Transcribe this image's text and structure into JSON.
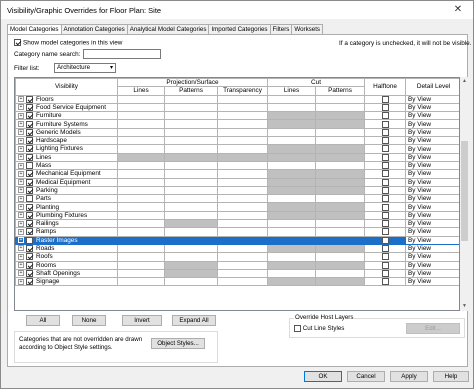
{
  "window": {
    "title": "Visibility/Graphic Overrides for Floor Plan: Site",
    "close_glyph": "✕"
  },
  "tabs": [
    {
      "label": "Model Categories",
      "active": true
    },
    {
      "label": "Annotation Categories",
      "active": false
    },
    {
      "label": "Analytical Model Categories",
      "active": false
    },
    {
      "label": "Imported Categories",
      "active": false
    },
    {
      "label": "Filters",
      "active": false
    },
    {
      "label": "Worksets",
      "active": false
    }
  ],
  "options": {
    "show_model_categories_label": "Show model categories in this view",
    "show_model_categories_checked": true,
    "hint": "If a category is unchecked, it will not be visible.",
    "category_search_label": "Category name search:",
    "category_search_value": "",
    "filter_list_label": "Filter list:",
    "filter_list_value": "Architecture",
    "dropdown_icon": "chevron-down-icon"
  },
  "table": {
    "headers": {
      "visibility": "Visibility",
      "projection_surface": "Projection/Surface",
      "cut": "Cut",
      "halftone": "Halftone",
      "detail_level": "Detail Level",
      "lines": "Lines",
      "patterns": "Patterns",
      "transparency": "Transparency",
      "cut_lines": "Lines",
      "cut_patterns": "Patterns"
    },
    "rows": [
      {
        "name": "Floors",
        "checked": true,
        "cut_gray": false,
        "proj_gray": false,
        "detail": "By View",
        "selected": false
      },
      {
        "name": "Food Service Equipment",
        "checked": true,
        "cut_gray": false,
        "proj_gray": false,
        "detail": "By View",
        "selected": false
      },
      {
        "name": "Furniture",
        "checked": true,
        "cut_gray": true,
        "proj_gray": false,
        "detail": "By View",
        "selected": false
      },
      {
        "name": "Furniture Systems",
        "checked": true,
        "cut_gray": true,
        "proj_gray": false,
        "detail": "By View",
        "selected": false
      },
      {
        "name": "Generic Models",
        "checked": true,
        "cut_gray": false,
        "proj_gray": false,
        "detail": "By View",
        "selected": false
      },
      {
        "name": "Hardscape",
        "checked": true,
        "cut_gray": false,
        "proj_gray": false,
        "detail": "By View",
        "selected": false
      },
      {
        "name": "Lighting Fixtures",
        "checked": true,
        "cut_gray": true,
        "proj_gray": false,
        "detail": "By View",
        "selected": false
      },
      {
        "name": "Lines",
        "checked": true,
        "cut_gray": true,
        "proj_gray": true,
        "detail": "By View",
        "selected": false
      },
      {
        "name": "Mass",
        "checked": false,
        "cut_gray": false,
        "proj_gray": false,
        "detail": "By View",
        "selected": false
      },
      {
        "name": "Mechanical Equipment",
        "checked": true,
        "cut_gray": true,
        "proj_gray": false,
        "detail": "By View",
        "selected": false
      },
      {
        "name": "Medical Equipment",
        "checked": true,
        "cut_gray": true,
        "proj_gray": false,
        "detail": "By View",
        "selected": false
      },
      {
        "name": "Parking",
        "checked": true,
        "cut_gray": true,
        "proj_gray": false,
        "detail": "By View",
        "selected": false
      },
      {
        "name": "Parts",
        "checked": false,
        "cut_gray": false,
        "proj_gray": false,
        "detail": "By View",
        "selected": false
      },
      {
        "name": "Planting",
        "checked": true,
        "cut_gray": true,
        "proj_gray": false,
        "detail": "By View",
        "selected": false
      },
      {
        "name": "Plumbing Fixtures",
        "checked": true,
        "cut_gray": true,
        "proj_gray": false,
        "detail": "By View",
        "selected": false
      },
      {
        "name": "Railings",
        "checked": true,
        "cut_gray": false,
        "proj_gray": false,
        "detail": "By View",
        "selected": false,
        "partial_gray": true
      },
      {
        "name": "Ramps",
        "checked": true,
        "cut_gray": false,
        "proj_gray": false,
        "detail": "By View",
        "selected": false
      },
      {
        "name": "Raster Images",
        "checked": false,
        "cut_gray": false,
        "proj_gray": false,
        "detail": "By View",
        "selected": true
      },
      {
        "name": "Roads",
        "checked": true,
        "cut_gray": true,
        "proj_gray": false,
        "detail": "By View",
        "selected": false
      },
      {
        "name": "Roofs",
        "checked": true,
        "cut_gray": false,
        "proj_gray": false,
        "detail": "By View",
        "selected": false
      },
      {
        "name": "Rooms",
        "checked": true,
        "cut_gray": true,
        "proj_gray": false,
        "detail": "By View",
        "selected": false,
        "partial_gray": true
      },
      {
        "name": "Shaft Openings",
        "checked": true,
        "cut_gray": false,
        "proj_gray": false,
        "detail": "By View",
        "selected": false,
        "partial_gray": true
      },
      {
        "name": "Signage",
        "checked": true,
        "cut_gray": true,
        "proj_gray": false,
        "detail": "By View",
        "selected": false
      }
    ],
    "expander_glyph": "+"
  },
  "buttons": {
    "all": "All",
    "none": "None",
    "invert": "Invert",
    "expand_all": "Expand All",
    "object_styles": "Object Styles...",
    "edit": "Edit...",
    "ok": "OK",
    "cancel": "Cancel",
    "apply": "Apply",
    "help": "Help"
  },
  "footer": {
    "note": "Categories that are not overridden are drawn according to Object Style settings.",
    "override_host_layers": "Override Host Layers",
    "cut_line_styles": "Cut Line Styles",
    "cut_line_styles_checked": false
  }
}
